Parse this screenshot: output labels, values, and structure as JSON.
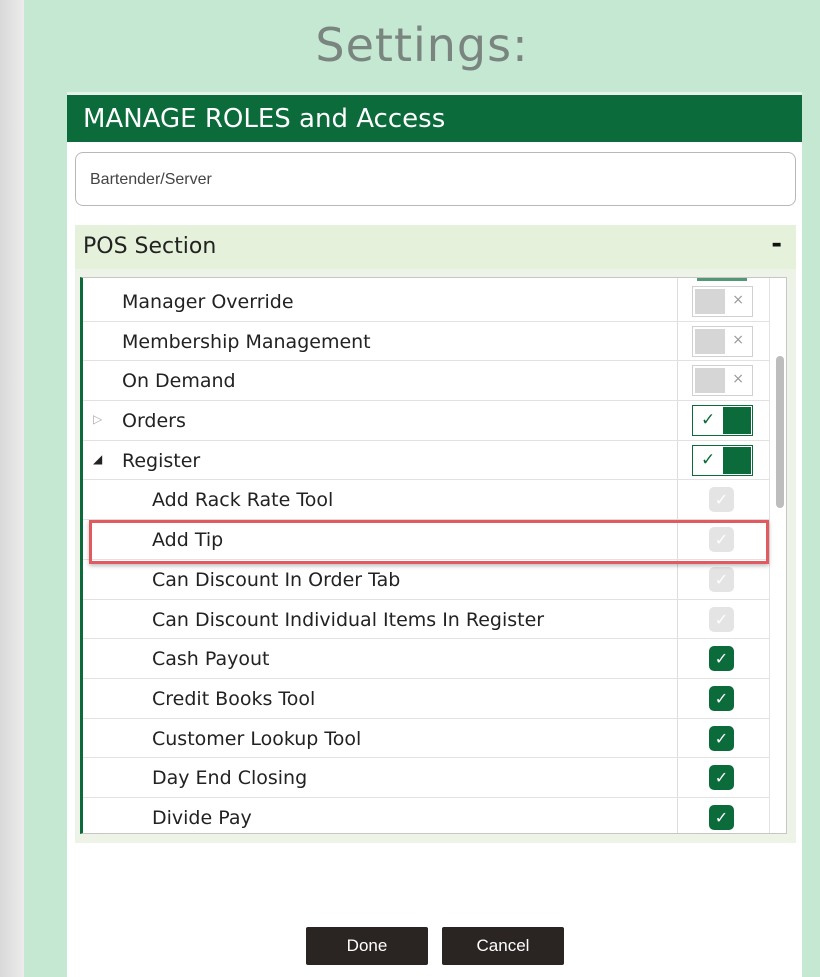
{
  "page_title": "Settings:",
  "panel": {
    "header": "MANAGE ROLES and Access",
    "role_value": "Bartender/Server"
  },
  "section": {
    "title": "POS Section",
    "collapse_symbol": "-"
  },
  "rows": [
    {
      "label": "Manager Override",
      "control": "toggle",
      "state": "off"
    },
    {
      "label": "Membership Management",
      "control": "toggle",
      "state": "off"
    },
    {
      "label": "On Demand",
      "control": "toggle",
      "state": "off"
    },
    {
      "label": "Orders",
      "control": "toggle",
      "state": "on",
      "expander": "collapsed"
    },
    {
      "label": "Register",
      "control": "toggle",
      "state": "on",
      "expander": "expanded"
    },
    {
      "label": "Add Rack Rate Tool",
      "control": "checkbox",
      "state": "disabled"
    },
    {
      "label": "Add Tip",
      "control": "checkbox",
      "state": "disabled",
      "highlighted": true
    },
    {
      "label": "Can Discount In Order Tab",
      "control": "checkbox",
      "state": "disabled"
    },
    {
      "label": "Can Discount Individual Items In Register",
      "control": "checkbox",
      "state": "disabled"
    },
    {
      "label": "Cash Payout",
      "control": "checkbox",
      "state": "checked"
    },
    {
      "label": "Credit Books Tool",
      "control": "checkbox",
      "state": "checked"
    },
    {
      "label": "Customer Lookup Tool",
      "control": "checkbox",
      "state": "checked"
    },
    {
      "label": "Day End Closing",
      "control": "checkbox",
      "state": "checked"
    },
    {
      "label": "Divide Pay",
      "control": "checkbox",
      "state": "checked"
    }
  ],
  "icons": {
    "toggle_off": "×",
    "toggle_on": "✓",
    "check": "✓",
    "expander_collapsed": "▷",
    "expander_expanded": "◢"
  },
  "colors": {
    "brand_green": "#0b6b3a",
    "highlight_red": "#e05a5f",
    "background_mint": "#c4e8d2"
  },
  "buttons": {
    "done": "Done",
    "cancel": "Cancel"
  }
}
